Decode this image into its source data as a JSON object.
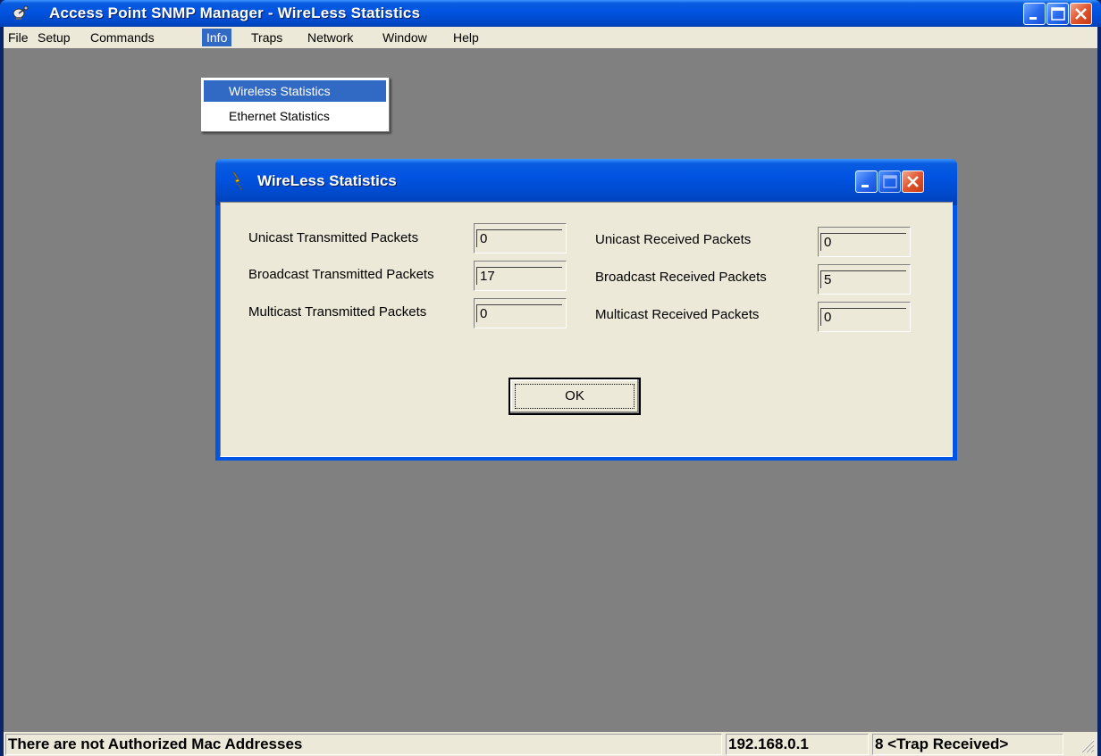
{
  "window": {
    "title": "Access Point SNMP Manager -  WireLess Statistics",
    "app_icon": "satellite-dish-icon",
    "controls": [
      "minimize-icon",
      "maximize-icon",
      "close-icon"
    ]
  },
  "menubar": {
    "items": [
      "File",
      "Setup",
      "Commands",
      "Info",
      "Traps",
      "Network",
      "Window",
      "Help"
    ],
    "active": "Info"
  },
  "dropdown": {
    "items": [
      "Wireless Statistics",
      "Ethernet Statistics"
    ],
    "highlighted": "Wireless Statistics"
  },
  "dialog": {
    "title": "WireLess Statistics",
    "icon": "lightning-icon",
    "left": [
      {
        "label": "Unicast Transmitted Packets",
        "value": "0"
      },
      {
        "label": "Broadcast Transmitted Packets",
        "value": "17"
      },
      {
        "label": "Multicast Transmitted Packets",
        "value": "0"
      }
    ],
    "right": [
      {
        "label": "Unicast Received Packets",
        "value": "0"
      },
      {
        "label": "Broadcast Received Packets",
        "value": "5"
      },
      {
        "label": "Multicast Received Packets",
        "value": "0"
      }
    ],
    "ok_label": "OK"
  },
  "statusbar": {
    "message": "There are not Authorized Mac Addresses",
    "ip": "192.168.0.1",
    "traps": "8 <Trap Received>"
  },
  "colors": {
    "title_blue": "#0053e1",
    "mdi_background": "#808080",
    "face": "#ece9d8",
    "highlight": "#316ac5",
    "close_red": "#e0552e"
  }
}
